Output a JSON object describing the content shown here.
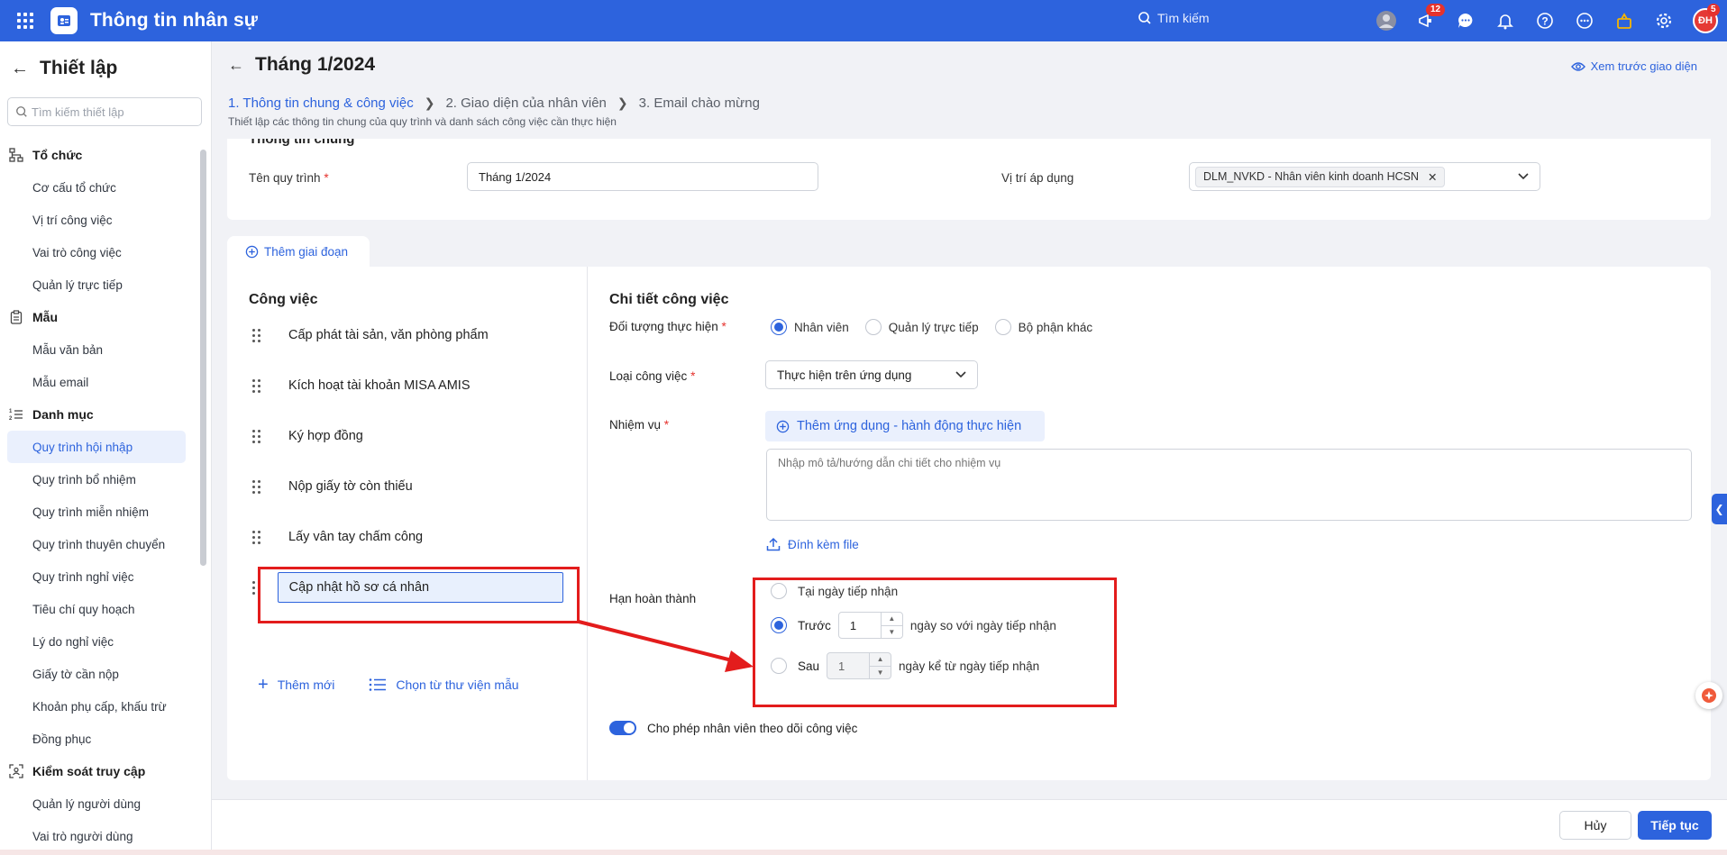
{
  "topbar": {
    "app_title": "Thông tin nhân sự",
    "search_label": "Tìm kiếm",
    "announce_badge": "12",
    "avatar_initials": "ĐH",
    "avatar_badge": "5",
    "accent_color": "#2d63dd"
  },
  "sidebar": {
    "title": "Thiết lập",
    "search_placeholder": "Tìm kiếm thiết lập",
    "groups": [
      {
        "label": "Tổ chức",
        "icon": "org-chart-icon",
        "items": [
          "Cơ cấu tổ chức",
          "Vị trí công việc",
          "Vai trò công việc",
          "Quản lý trực tiếp"
        ]
      },
      {
        "label": "Mẫu",
        "icon": "clipboard-icon",
        "items": [
          "Mẫu văn bản",
          "Mẫu email"
        ]
      },
      {
        "label": "Danh mục",
        "icon": "list-icon",
        "items": [
          "Quy trình hội nhập",
          "Quy trình bổ nhiệm",
          "Quy trình miễn nhiệm",
          "Quy trình thuyên chuyển",
          "Quy trình nghỉ việc",
          "Tiêu chí quy hoạch",
          "Lý do nghỉ việc",
          "Giấy tờ cần nộp",
          "Khoản phụ cấp, khấu trừ",
          "Đồng phục"
        ]
      },
      {
        "label": "Kiểm soát truy cập",
        "icon": "access-control-icon",
        "items": [
          "Quản lý người dùng",
          "Vai trò người dùng"
        ]
      }
    ],
    "active_item": "Quy trình hội nhập"
  },
  "page": {
    "title": "Tháng 1/2024",
    "preview_label": "Xem trước giao diện",
    "steps": [
      "1. Thông tin chung & công việc",
      "2. Giao diện của nhân viên",
      "3. Email chào mừng"
    ],
    "step_description": "Thiết lập các thông tin chung của quy trình và danh sách công việc cần thực hiện"
  },
  "general": {
    "section_title": "Thông tin chung",
    "process_name_label": "Tên quy trình",
    "process_name_value": "Tháng 1/2024",
    "position_label": "Vị trí áp dụng",
    "position_chip": "DLM_NVKD - Nhân viên kinh doanh HCSN"
  },
  "stage": {
    "add_stage_label": "Thêm giai đoạn"
  },
  "tasks": {
    "title": "Công việc",
    "items": [
      "Cấp phát tài sản, văn phòng phẩm",
      "Kích hoạt tài khoản MISA AMIS",
      "Ký hợp đồng",
      "Nộp giấy tờ còn thiếu",
      "Lấy vân tay chấm công",
      "Cập nhật hồ sơ cá nhân"
    ],
    "selected": "Cập nhật hồ sơ cá nhân",
    "add_new_label": "Thêm mới",
    "from_library_label": "Chọn từ thư viện mẫu"
  },
  "detail": {
    "title": "Chi tiết công việc",
    "performer_label": "Đối tượng thực hiện",
    "performer_options": [
      "Nhân viên",
      "Quản lý trực tiếp",
      "Bộ phận khác"
    ],
    "performer_selected": "Nhân viên",
    "task_type_label": "Loại công việc",
    "task_type_value": "Thực hiện trên ứng dụng",
    "mission_label": "Nhiệm vụ",
    "add_app_action_label": "Thêm ứng dụng - hành động thực hiện",
    "mission_placeholder": "Nhập mô tả/hướng dẫn chi tiết cho nhiệm vụ",
    "attach_label": "Đính kèm file",
    "deadline_label": "Hạn hoàn thành",
    "deadline_options": {
      "on_day": "Tại ngày tiếp nhận",
      "before_label": "Trước",
      "before_value": "1",
      "before_suffix": "ngày so với ngày tiếp nhận",
      "after_label": "Sau",
      "after_value": "1",
      "after_suffix": "ngày kể từ ngày tiếp nhận"
    },
    "deadline_selected": "Trước",
    "follow_toggle_label": "Cho phép nhân viên theo dõi công việc",
    "follow_toggle_on": true
  },
  "footer": {
    "cancel_label": "Hủy",
    "continue_label": "Tiếp tục"
  },
  "annotation_color": "#e31c1c"
}
